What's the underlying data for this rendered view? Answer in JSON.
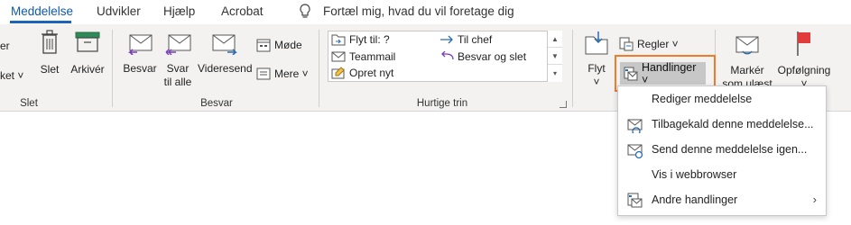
{
  "tabs": [
    {
      "label": "Meddelelse",
      "active": true
    },
    {
      "label": "Udvikler",
      "active": false
    },
    {
      "label": "Hjælp",
      "active": false
    },
    {
      "label": "Acrobat",
      "active": false
    }
  ],
  "tell_me": {
    "icon": "lightbulb-icon",
    "placeholder": "Fortæl mig, hvad du vil foretage dig"
  },
  "groups": {
    "slet": {
      "label": "Slet",
      "partial_labels": [
        "er",
        "ket ˅"
      ],
      "buttons": [
        {
          "label": "Slet",
          "icon": "trash-icon"
        },
        {
          "label": "Arkivér",
          "icon": "archive-icon"
        }
      ]
    },
    "besvar": {
      "label": "Besvar",
      "buttons": [
        {
          "label": "Besvar",
          "icon": "reply-icon"
        },
        {
          "label": "Svar",
          "label2": "til alle",
          "icon": "reply-all-icon"
        },
        {
          "label": "Videresend",
          "icon": "forward-icon"
        }
      ],
      "small": [
        {
          "label": "Møde",
          "icon": "calendar-icon"
        },
        {
          "label": "Mere ˅",
          "icon": "more-icon"
        }
      ]
    },
    "hurtige_trin": {
      "label": "Hurtige trin",
      "items": [
        {
          "label": "Flyt til: ?",
          "icon": "move-folder-icon"
        },
        {
          "label": "Til chef",
          "icon": "arrow-right-icon"
        },
        {
          "label": "Teammail",
          "icon": "team-mail-icon"
        },
        {
          "label": "Besvar og slet",
          "icon": "reply-delete-icon"
        },
        {
          "label": "Opret nyt",
          "icon": "new-step-icon"
        }
      ]
    },
    "flyt": {
      "button": {
        "label": "Flyt",
        "icon": "move-icon",
        "chevron": "˅"
      },
      "regler": "Regler ˅",
      "handlinger": "Handlinger ˅"
    },
    "tags": {
      "buttons": [
        {
          "label": "Markér",
          "label2": "som ulæst",
          "icon": "mark-unread-icon"
        },
        {
          "label": "Opfølgning",
          "label2": "˅",
          "icon": "flag-icon"
        }
      ]
    }
  },
  "menu": {
    "items": [
      {
        "label": "Rediger meddelelse",
        "icon": ""
      },
      {
        "label": "Tilbagekald denne meddelelse...",
        "icon": "recall-icon"
      },
      {
        "label": "Send denne meddelelse igen...",
        "icon": "resend-icon"
      },
      {
        "label": "Vis i webbrowser",
        "icon": ""
      },
      {
        "label": "Andre handlinger",
        "icon": "other-actions-icon",
        "submenu": true
      }
    ]
  },
  "colors": {
    "accent": "#1a64b9",
    "highlight": "#f07b2b",
    "ribbon_bg": "#f3f2f1",
    "icon_blue": "#2b6cb0",
    "icon_purple": "#7a3db8",
    "flag_red": "#e23b3b"
  }
}
